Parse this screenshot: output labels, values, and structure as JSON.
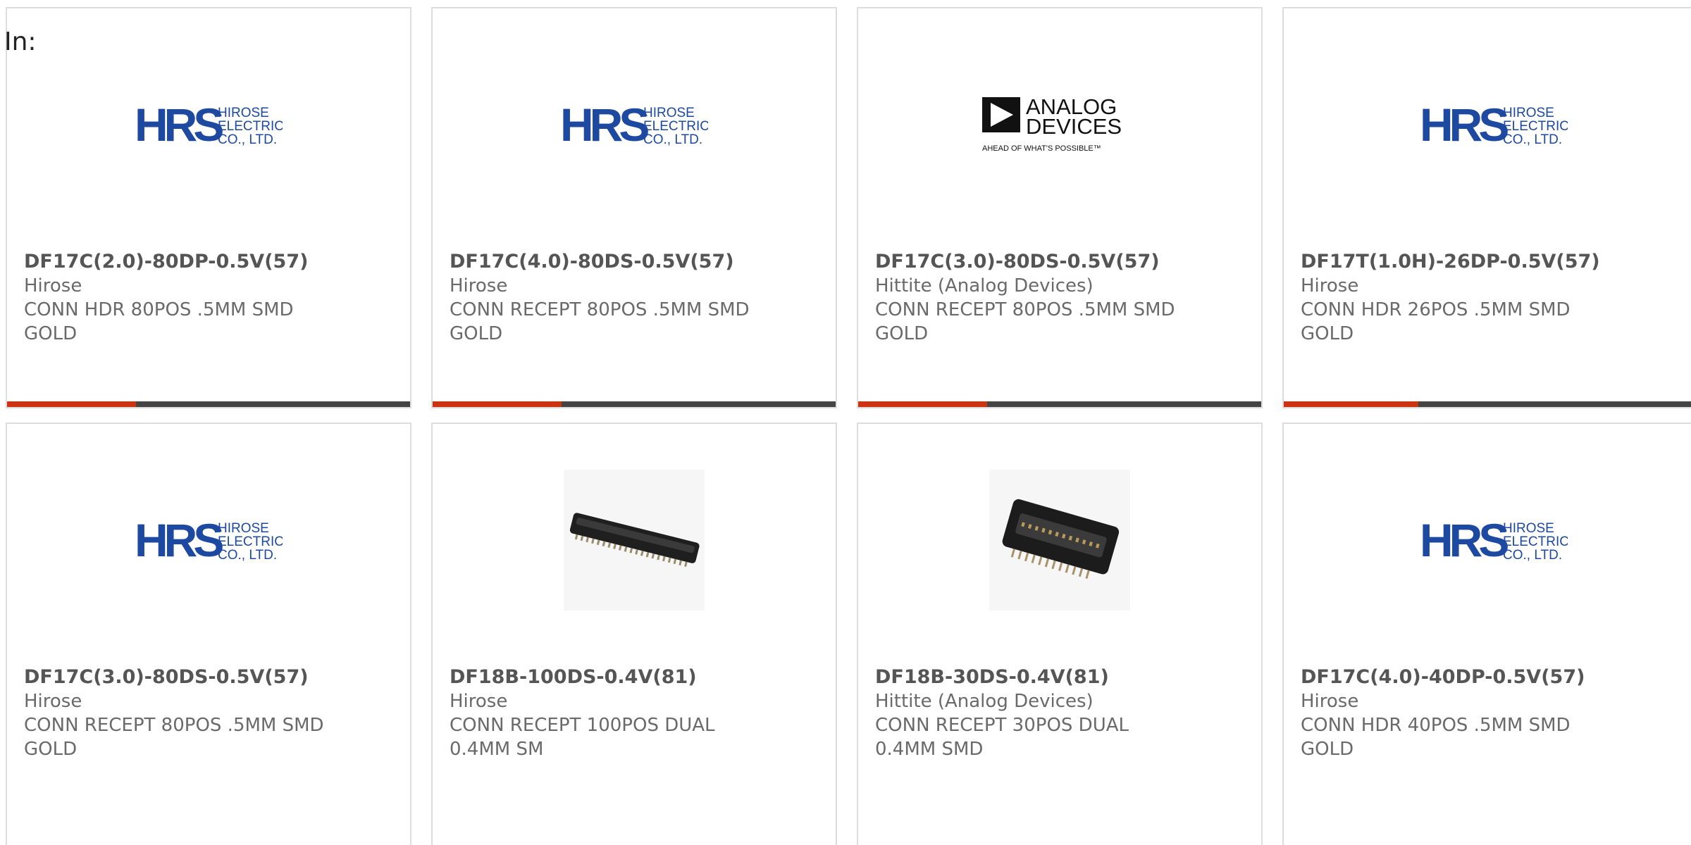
{
  "prefix_label": "In:",
  "colors": {
    "accent": "#cc3411",
    "bar_track": "#444444",
    "hrs_blue": "#1d4aa0",
    "text": "#666666"
  },
  "cards": [
    {
      "part_number": "DF17C(2.0)-80DP-0.5V(57)",
      "manufacturer": "Hirose",
      "description": "CONN HDR 80POS .5MM SMD GOLD",
      "image": "hirose-logo",
      "logo_text": [
        "HIROSE",
        "ELECTRIC",
        "CO., LTD."
      ],
      "progress_fraction": 0.32
    },
    {
      "part_number": "DF17C(4.0)-80DS-0.5V(57)",
      "manufacturer": "Hirose",
      "description": "CONN RECEPT 80POS .5MM SMD GOLD",
      "image": "hirose-logo",
      "logo_text": [
        "HIROSE",
        "ELECTRIC",
        "CO., LTD."
      ],
      "progress_fraction": 0.32
    },
    {
      "part_number": "DF17C(3.0)-80DS-0.5V(57)",
      "manufacturer": "Hittite (Analog Devices)",
      "description": "CONN RECEPT 80POS .5MM SMD GOLD",
      "image": "analog-devices-logo",
      "logo_text": [
        "ANALOG",
        "DEVICES",
        "AHEAD OF WHAT'S POSSIBLE™"
      ],
      "progress_fraction": 0.32
    },
    {
      "part_number": "DF17T(1.0H)-26DP-0.5V(57)",
      "manufacturer": "Hirose",
      "description": "CONN HDR 26POS .5MM SMD GOLD",
      "image": "hirose-logo",
      "logo_text": [
        "HIROSE",
        "ELECTRIC",
        "CO., LTD."
      ],
      "progress_fraction": 0.32
    },
    {
      "part_number": "DF17C(3.0)-80DS-0.5V(57)",
      "manufacturer": "Hirose",
      "description": "CONN RECEPT 80POS .5MM SMD GOLD",
      "image": "hirose-logo",
      "logo_text": [
        "HIROSE",
        "ELECTRIC",
        "CO., LTD."
      ]
    },
    {
      "part_number": "DF18B-100DS-0.4V(81)",
      "manufacturer": "Hirose",
      "description": "CONN RECEPT 100POS DUAL 0.4MM SM",
      "image": "connector-photo-long"
    },
    {
      "part_number": "DF18B-30DS-0.4V(81)",
      "manufacturer": "Hittite (Analog Devices)",
      "description": "CONN RECEPT 30POS DUAL 0.4MM SMD",
      "image": "connector-photo-short"
    },
    {
      "part_number": "DF17C(4.0)-40DP-0.5V(57)",
      "manufacturer": "Hirose",
      "description": "CONN HDR 40POS .5MM SMD GOLD",
      "image": "hirose-logo",
      "logo_text": [
        "HIROSE",
        "ELECTRIC",
        "CO., LTD."
      ]
    }
  ]
}
